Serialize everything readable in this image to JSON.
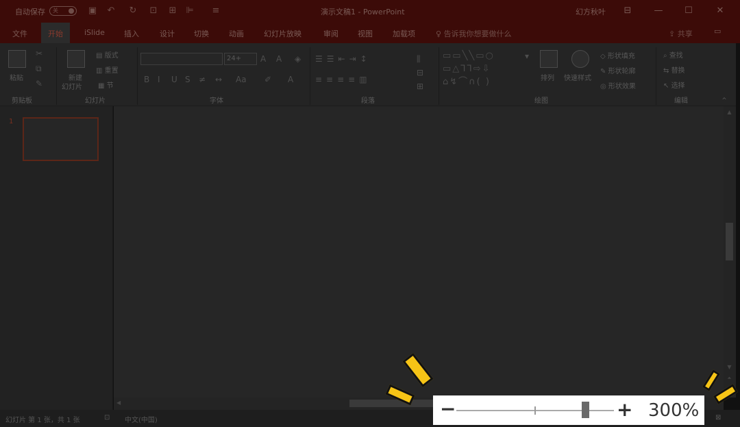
{
  "titlebar": {
    "autosave": "自动保存",
    "toggle": "关",
    "title": "演示文稿1 - PowerPoint",
    "plugin": "幻方秋叶"
  },
  "tabs": [
    "文件",
    "开始",
    "iSlide",
    "插入",
    "设计",
    "切换",
    "动画",
    "幻灯片放映",
    "审阅",
    "视图",
    "加载项"
  ],
  "tell_me": "告诉我你想要做什么",
  "share": "共享",
  "ribbon": {
    "clipboard": {
      "paste": "粘贴",
      "label": "剪贴板"
    },
    "slides": {
      "new1": "新建",
      "new2": "幻灯片",
      "layout": "版式",
      "reset": "重置",
      "section": "节",
      "label": "幻灯片"
    },
    "font": {
      "size": "24+",
      "label": "字体"
    },
    "paragraph": {
      "label": "段落"
    },
    "drawing": {
      "arrange": "排列",
      "quick_styles": "快速样式",
      "fill": "形状填充",
      "outline": "形状轮廓",
      "effects": "形状效果",
      "label": "绘图"
    },
    "editing": {
      "find": "查找",
      "replace": "替换",
      "select": "选择",
      "label": "编辑"
    }
  },
  "thumbnails": {
    "slide_number": "1"
  },
  "status": {
    "slide_info": "幻灯片 第 1 张，共 1 张",
    "language": "中文(中国)"
  },
  "zoom": {
    "minus": "−",
    "plus": "+",
    "percent": "300%",
    "level": 300
  },
  "colors": {
    "titlebar": "#3c0b08",
    "accent": "#8a3a2c",
    "highlight_rays": "#f6c416"
  }
}
